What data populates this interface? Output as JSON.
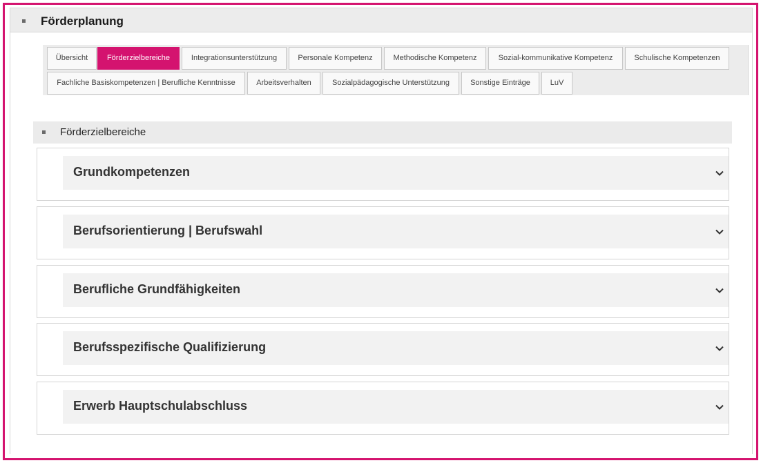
{
  "panel": {
    "title": "Förderplanung"
  },
  "tabs": [
    {
      "label": "Übersicht",
      "active": false
    },
    {
      "label": "Förderzielbereiche",
      "active": true
    },
    {
      "label": "Integrationsunterstützung",
      "active": false
    },
    {
      "label": "Personale Kompetenz",
      "active": false
    },
    {
      "label": "Methodische Kompetenz",
      "active": false
    },
    {
      "label": "Sozial-kommunikative Kompetenz",
      "active": false
    },
    {
      "label": "Schulische Kompetenzen",
      "active": false
    },
    {
      "label": "Fachliche Basiskompetenzen | Berufliche Kenntnisse",
      "active": false
    },
    {
      "label": "Arbeitsverhalten",
      "active": false
    },
    {
      "label": "Sozialpädagogische Unterstützung",
      "active": false
    },
    {
      "label": "Sonstige Einträge",
      "active": false
    },
    {
      "label": "LuV",
      "active": false
    }
  ],
  "section": {
    "title": "Förderzielbereiche"
  },
  "accordions": [
    {
      "title": "Grundkompetenzen"
    },
    {
      "title": "Berufsorientierung | Berufswahl"
    },
    {
      "title": "Berufliche Grundfähigkeiten"
    },
    {
      "title": "Berufsspezifische Qualifizierung"
    },
    {
      "title": "Erwerb Hauptschulabschluss"
    }
  ],
  "colors": {
    "accent": "#d4136f",
    "header_bg": "#ececec",
    "accordion_bg": "#f2f2f2"
  }
}
